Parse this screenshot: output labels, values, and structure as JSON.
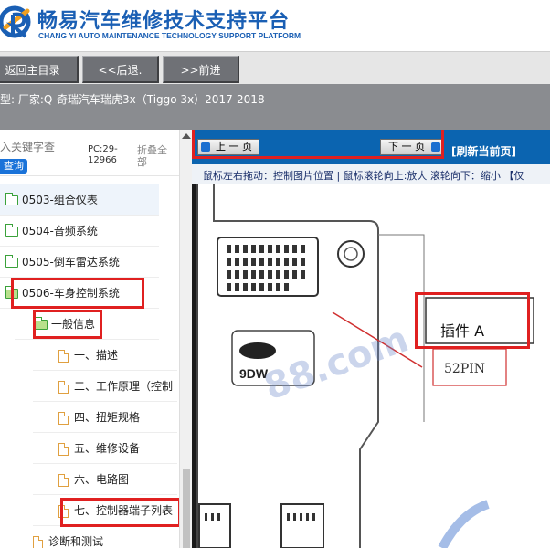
{
  "header": {
    "brand_cn": "畅易汽车维修技术支持平台",
    "brand_en": "CHANG YI AUTO MAINTENANCE TECHNOLOGY SUPPORT PLATFORM",
    "logo_icon": "changyi-logo-icon",
    "accent_color": "#1a5fb4"
  },
  "nav": {
    "home_label": "返回主目录",
    "back_label": "<<后退.",
    "forward_label": ">>前进"
  },
  "model": {
    "text": "型:  厂家:Q-奇瑞汽车瑞虎3x（Tiggo 3x）2017-2018"
  },
  "sidebar": {
    "search_placeholder": "入关键字查",
    "search_button": "查询",
    "pc_code": "PC:29-12966",
    "collapse_all": "折叠全部",
    "items": [
      {
        "label": "0503-组合仪表",
        "icon": "folder-icon"
      },
      {
        "label": "0504-音频系统",
        "icon": "folder-icon"
      },
      {
        "label": "0505-倒车雷达系统",
        "icon": "folder-icon"
      },
      {
        "label": "0506-车身控制系统",
        "icon": "folder-open-icon"
      },
      {
        "label": "一般信息",
        "icon": "folder-open-icon"
      },
      {
        "label": "一、描述",
        "icon": "document-icon"
      },
      {
        "label": "二、工作原理（控制",
        "icon": "document-icon"
      },
      {
        "label": "四、扭矩规格",
        "icon": "document-icon"
      },
      {
        "label": "五、维修设备",
        "icon": "document-icon"
      },
      {
        "label": "六、电路图",
        "icon": "document-icon"
      },
      {
        "label": "七、控制器端子列表",
        "icon": "document-icon"
      },
      {
        "label": "诊断和测试",
        "icon": "document-icon"
      }
    ]
  },
  "viewer": {
    "prev_page": "上 一 页",
    "next_page": "下 一 页",
    "refresh": "[刷新当前页]",
    "hint": "鼠标左右拖动：控制图片位置 | 鼠标滚轮向上:放大  滚轮向下：缩小 【仅",
    "diagram": {
      "connector_callout": "插件 A",
      "pin_count": "52PIN",
      "chip_label": "9DW",
      "watermark": "88.com"
    }
  }
}
